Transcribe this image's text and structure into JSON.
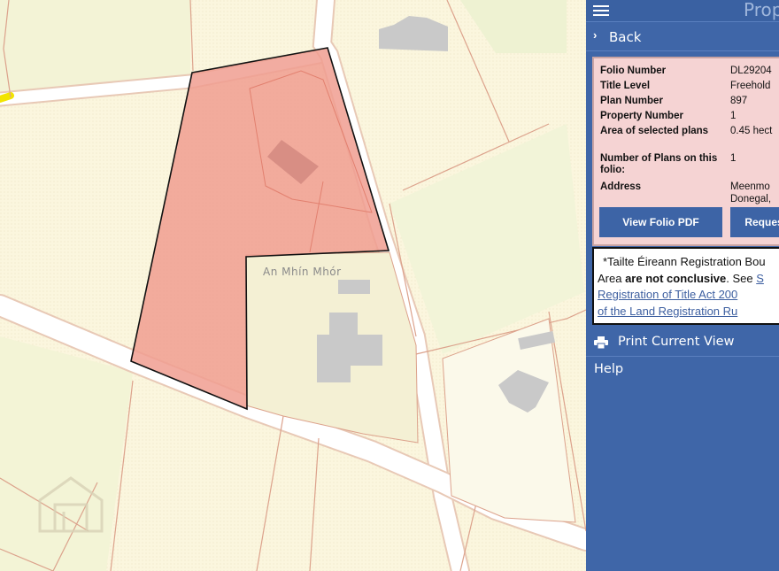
{
  "map": {
    "place_label": "An Mhín Mhór",
    "colors": {
      "background": "#fbf6de",
      "road": "#ffffff",
      "parcel_fill": "#f09e90",
      "parcel_border": "#111111",
      "boundary": "#e2a08a",
      "building": "#c9c9c9"
    }
  },
  "panel": {
    "title": "Prop",
    "back_label": "Back",
    "folio": {
      "rows": [
        {
          "key": "Folio Number",
          "value": "DL29204"
        },
        {
          "key": "Title Level",
          "value": "Freehold"
        },
        {
          "key": "Plan Number",
          "value": "897"
        },
        {
          "key": "Property Number",
          "value": "1"
        },
        {
          "key": "Area of selected plans",
          "value": "0.45 hect"
        },
        {
          "key": "Number of Plans on this folio:",
          "value": "1"
        },
        {
          "key": "Address",
          "value": "Meenmo",
          "value2": "Donegal,"
        }
      ],
      "view_pdf_label": "View Folio PDF",
      "request_label": "Request"
    },
    "note": {
      "line1": "*Tailte Éireann Registration Bou",
      "line2_pre": "Area ",
      "line2_bold": "are not conclusive",
      "line2_post": ". See ",
      "line2_link": "S",
      "link_line3": "Registration of Title Act 200",
      "link_line4": "of the Land Registration Ru"
    },
    "print_label": "Print Current View",
    "help_label": "Help",
    "colors": {
      "panel_bg": "#3f66a8",
      "folio_bg": "#f5d3d3",
      "button_bg": "#3d64a6"
    }
  }
}
